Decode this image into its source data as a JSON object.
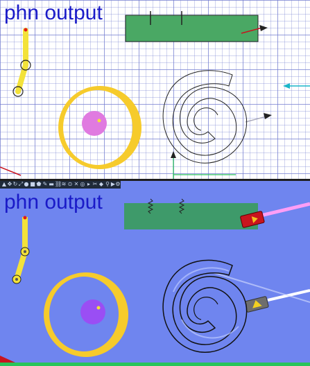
{
  "editor_view": {
    "title": "phn output"
  },
  "sim_view": {
    "title": "phn output",
    "toolbar_icons": [
      "select-icon",
      "move-icon",
      "rotate-icon",
      "scale-icon",
      "circle-tool-icon",
      "box-tool-icon",
      "polygon-tool-icon",
      "brush-tool-icon",
      "plane-tool-icon",
      "chain-tool-icon",
      "spring-tool-icon",
      "hinge-tool-icon",
      "fixjoint-tool-icon",
      "tracer-tool-icon",
      "laser-tool-icon",
      "cut-tool-icon",
      "eraser-tool-icon",
      "zoom-icon",
      "play-icon",
      "settings-icon"
    ]
  },
  "colors": {
    "title": "#1a1ac8",
    "sim_background": "#6f85ef",
    "box_editor": "#4aa864",
    "box_sim": "#3e9a6a",
    "ring": "#f6cb2c",
    "editor_ball": "#e07ae0",
    "sim_ball": "#9a4ef4",
    "laser_red": "#c8141e",
    "laser_gray": "#6e6e6e",
    "pink_beam": "#ff9ef6"
  }
}
